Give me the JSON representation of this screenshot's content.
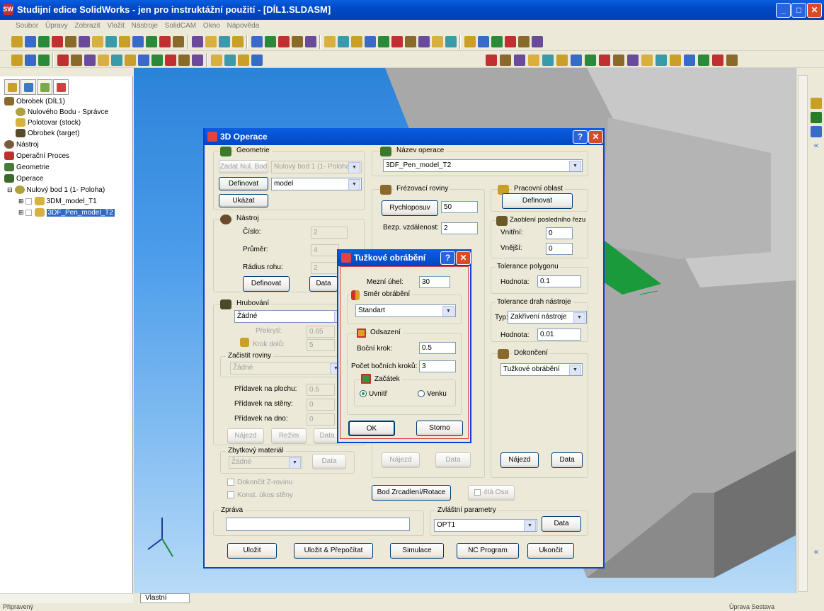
{
  "window": {
    "title": "Studijní edice SolidWorks - jen pro instruktážní použití - [DÍL1.SLDASM]"
  },
  "menu": [
    "Soubor",
    "Úpravy",
    "Zobrazit",
    "Vložit",
    "Nástroje",
    "SolidCAM",
    "Okno",
    "Nápověda"
  ],
  "tree": {
    "root": "Obrobek (DÍL1)",
    "items": [
      "Nulového Bodu - Správce",
      "Polotovar (stock)",
      "Obrobek (target)"
    ],
    "nastroj": "Nástroj",
    "proces": "Operační Proces",
    "geometrie": "Geometrie",
    "operace": "Operace",
    "nulovy": "Nulový bod 1 (1- Poloha)",
    "op1": "3DM_model_T1",
    "op2": "3DF_Pen_model_T2"
  },
  "bottom": {
    "tab": "Vlastní"
  },
  "status": {
    "left": "Připravený",
    "right": "Úprava Sestava"
  },
  "dlg": {
    "title": "3D Operace",
    "geometrie": {
      "label": "Geometrie",
      "zadat": "Zadat Nul. Bod",
      "nulovy": "Nulový bod 1 (1- Poloha)",
      "definovat": "Definovat",
      "model": "model",
      "ukazat": "Ukázat"
    },
    "nastroj": {
      "label": "Nástroj",
      "cislo": "Číslo:",
      "cislo_v": "2",
      "prumer": "Průměr:",
      "prumer_v": "4",
      "radius": "Rádius rohu:",
      "radius_v": "2",
      "definovat": "Definovat",
      "data": "Data"
    },
    "hrubovani": {
      "label": "Hrubování",
      "value": "Žádné",
      "prekryti": "Překrytí:",
      "prekryti_v": "0.65",
      "krok": "Krok dolů:",
      "krok_v": "5"
    },
    "zacistit": {
      "label": "Začistit roviny",
      "value": "Žádné"
    },
    "pridavky": {
      "plocha": "Přídavek na plochu:",
      "plocha_v": "0.5",
      "steny": "Přídavek na stěny:",
      "steny_v": "0",
      "dno": "Přídavek na dno:",
      "dno_v": "0"
    },
    "nrd": {
      "najezd": "Nájezd",
      "rezim": "Režim",
      "data": "Data"
    },
    "zbytkovy": {
      "label": "Zbytkový materiál",
      "value": "Žádné",
      "data": "Data"
    },
    "dokoncit": "Dokončit Z-rovinu",
    "konst": "Konst. úkos stěny",
    "nazev": {
      "label": "Název operace",
      "value": "3DF_Pen_model_T2"
    },
    "frez": {
      "label": "Frézovací roviny",
      "rychlo": "Rychloposuv",
      "rychlo_v": "50",
      "bezp": "Bezp. vzdálenost:",
      "bezp_v": "2",
      "najezd": "Nájezd",
      "data": "Data"
    },
    "oblast": {
      "label": "Pracovní oblast",
      "definovat": "Definovat"
    },
    "zaobleni": {
      "label": "Zaoblení posledního řezu",
      "vnitrni": "Vnitřní:",
      "vnitrni_v": "0",
      "vnejsi": "Vnější:",
      "vnejsi_v": "0"
    },
    "polygon": {
      "label": "Tolerance polygonu",
      "hodnota": "Hodnota:",
      "hodnota_v": "0.1"
    },
    "drah": {
      "label": "Tolerance drah nástroje",
      "typ": "Typ:",
      "typ_v": "Zakřivení nástroje",
      "hodnota": "Hodnota:",
      "hodnota_v": "0.01"
    },
    "dokonceni": {
      "label": "Dokončení",
      "value": "Tužkové obrábění",
      "najezd": "Nájezd",
      "data": "Data"
    },
    "bod": "Bod Zrcadlení/Rotace",
    "osa": "4tá Osa",
    "zprava": "Zpráva",
    "zvlastni": {
      "label": "Zvláštní parametry",
      "value": "OPT1",
      "data": "Data"
    },
    "buttons": {
      "ulozit": "Uložit",
      "ulozit_prep": "Uložit & Přepočítat",
      "simulace": "Simulace",
      "nc": "NC Program",
      "ukoncit": "Ukončit"
    }
  },
  "sub": {
    "title": "Tužkové obrábění",
    "mezni": "Mezní úhel:",
    "mezni_v": "30",
    "smer": {
      "label": "Směr obrábění",
      "value": "Standart"
    },
    "odsazeni": {
      "label": "Odsazení",
      "bocni": "Boční krok:",
      "bocni_v": "0.5",
      "pocet": "Počet bočních kroků:",
      "pocet_v": "3"
    },
    "zacatek": {
      "label": "Začátek",
      "uvnitr": "Uvnitř",
      "venku": "Venku"
    },
    "ok": "OK",
    "storno": "Storno"
  },
  "colors": {
    "titlebar": "#0a5fe0",
    "viewport": "#4b9cea",
    "selection": "#316ac5"
  }
}
